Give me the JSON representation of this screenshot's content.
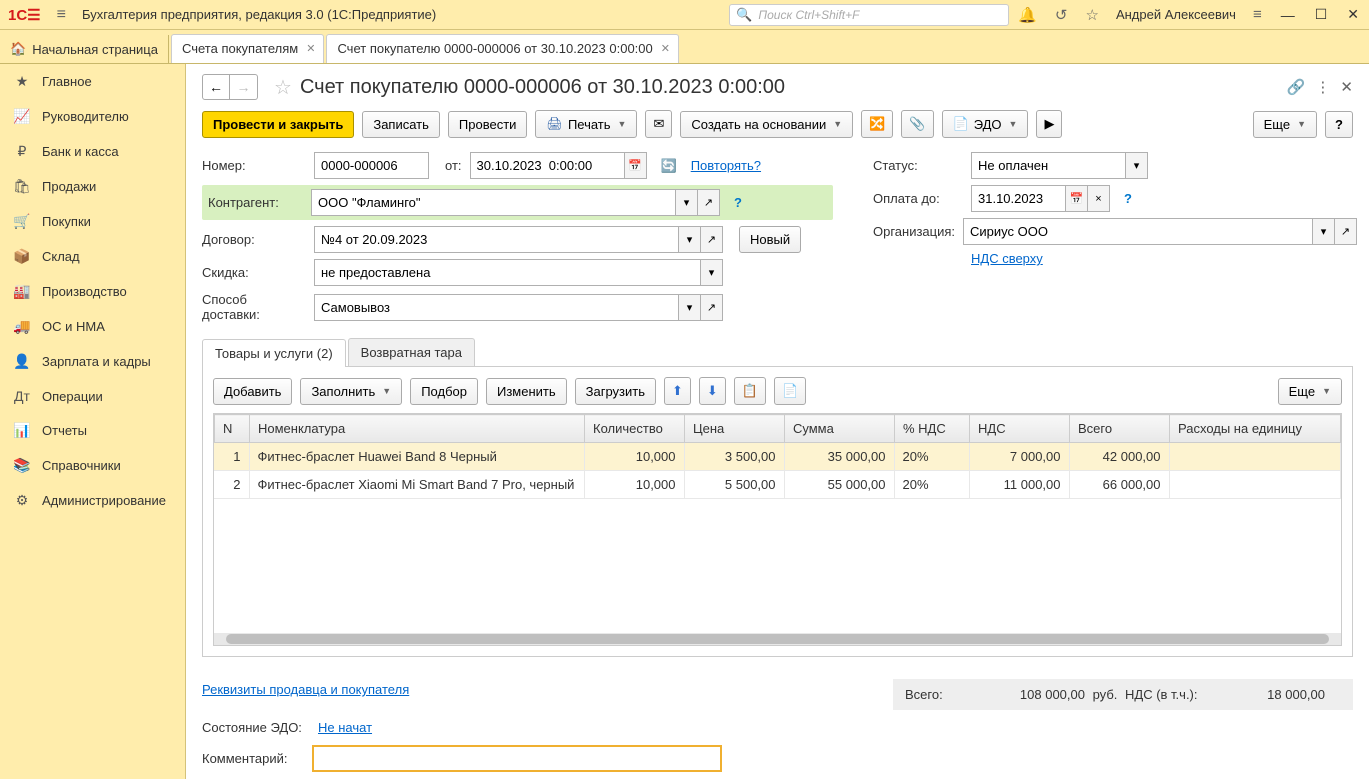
{
  "titlebar": {
    "app_title": "Бухгалтерия предприятия, редакция 3.0  (1С:Предприятие)",
    "search_placeholder": "Поиск Ctrl+Shift+F",
    "user_name": "Андрей Алексеевич"
  },
  "tabs": {
    "home_label": "Начальная страница",
    "items": [
      {
        "label": "Счета покупателям"
      },
      {
        "label": "Счет покупателю 0000-000006 от 30.10.2023 0:00:00"
      }
    ]
  },
  "sidebar": {
    "items": [
      {
        "icon": "★",
        "label": "Главное"
      },
      {
        "icon": "📈",
        "label": "Руководителю"
      },
      {
        "icon": "₽",
        "label": "Банк и касса"
      },
      {
        "icon": "🛍",
        "label": "Продажи"
      },
      {
        "icon": "🛒",
        "label": "Покупки"
      },
      {
        "icon": "📦",
        "label": "Склад"
      },
      {
        "icon": "🏭",
        "label": "Производство"
      },
      {
        "icon": "🚚",
        "label": "ОС и НМА"
      },
      {
        "icon": "👤",
        "label": "Зарплата и кадры"
      },
      {
        "icon": "Дт",
        "label": "Операции"
      },
      {
        "icon": "📊",
        "label": "Отчеты"
      },
      {
        "icon": "📚",
        "label": "Справочники"
      },
      {
        "icon": "⚙",
        "label": "Администрирование"
      }
    ]
  },
  "doc": {
    "title": "Счет покупателю 0000-000006 от 30.10.2023 0:00:00",
    "toolbar": {
      "post_close": "Провести и закрыть",
      "write": "Записать",
      "post": "Провести",
      "print": "Печать",
      "create_based": "Создать на основании",
      "edo": "ЭДО",
      "more": "Еще"
    },
    "fields": {
      "number_label": "Номер:",
      "number": "0000-000006",
      "from_label": "от:",
      "date": "30.10.2023  0:00:00",
      "repeat_link": "Повторять?",
      "kontragent_label": "Контрагент:",
      "kontragent": "ООО \"Фламинго\"",
      "dogovor_label": "Договор:",
      "dogovor": "№4 от 20.09.2023",
      "new_btn": "Новый",
      "skidka_label": "Скидка:",
      "skidka": "не предоставлена",
      "delivery_label": "Способ доставки:",
      "delivery": "Самовывоз",
      "status_label": "Статус:",
      "status": "Не оплачен",
      "pay_until_label": "Оплата до:",
      "pay_until": "31.10.2023",
      "org_label": "Организация:",
      "org": "Сириус ООО",
      "nds_link": "НДС сверху"
    },
    "tabpanel": {
      "tab1": "Товары и услуги (2)",
      "tab2": "Возвратная тара",
      "buttons": {
        "add": "Добавить",
        "fill": "Заполнить",
        "pick": "Подбор",
        "change": "Изменить",
        "load": "Загрузить",
        "more": "Еще"
      },
      "columns": [
        "N",
        "Номенклатура",
        "Количество",
        "Цена",
        "Сумма",
        "% НДС",
        "НДС",
        "Всего",
        "Расходы на единицу"
      ],
      "rows": [
        {
          "n": "1",
          "nom": "Фитнес-браслет Huawei Band 8 Черный",
          "qty": "10,000",
          "price": "3 500,00",
          "sum": "35 000,00",
          "vat": "20%",
          "nds": "7 000,00",
          "total": "42 000,00",
          "exp": ""
        },
        {
          "n": "2",
          "nom": "Фитнес-браслет Xiaomi Mi Smart Band 7 Pro, черный",
          "qty": "10,000",
          "price": "5 500,00",
          "sum": "55 000,00",
          "vat": "20%",
          "nds": "11 000,00",
          "total": "66 000,00",
          "exp": ""
        }
      ]
    },
    "totals": {
      "total_label": "Всего:",
      "total_value": "108 000,00",
      "rub": "руб.",
      "nds_label": "НДС (в т.ч.):",
      "nds_value": "18 000,00"
    },
    "bottom": {
      "requisites_link": "Реквизиты продавца и покупателя",
      "edo_state_label": "Состояние ЭДО:",
      "edo_state_link": "Не начат",
      "comment_label": "Комментарий:"
    }
  }
}
